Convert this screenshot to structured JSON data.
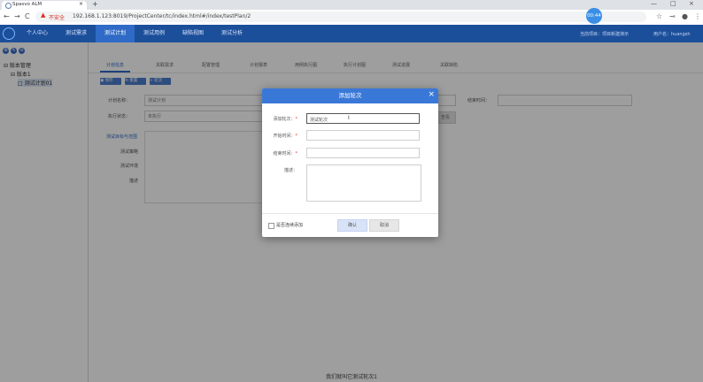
{
  "browser": {
    "tab_title": "Spasvo ALM",
    "tab_close": "×",
    "new_tab": "+",
    "back": "←",
    "forward": "→",
    "reload": "C",
    "insecure_label": "不安全",
    "url": "192.168.1.123:8019/ProjectCenter/tc/index.html#/index/testPlan/2",
    "window_controls": [
      "—",
      "□",
      "×"
    ],
    "toolbar_icons": [
      "☆",
      "⊸",
      "●",
      "⋮"
    ]
  },
  "recording_timer": "00:44",
  "app_nav": {
    "items": [
      "个人中心",
      "测试需求",
      "测试计划",
      "测试用例",
      "缺陷视图",
      "测试分析"
    ],
    "active_index": 2,
    "current_project": "当前项目：项目新建演示",
    "user": "用户名：huangsh"
  },
  "sidebar": {
    "buttons": [
      "⊕",
      "✎",
      "⊖"
    ],
    "tree": [
      {
        "label": "⊟ 版本管理",
        "level": 0
      },
      {
        "label": "⊟ 版本1",
        "level": 1
      },
      {
        "label": "□ 测试计划01",
        "level": 2
      }
    ]
  },
  "subtabs": [
    "计划信息",
    "关联需求",
    "配置管理",
    "计划报表",
    "用例执行图",
    "执行计划图",
    "测试进展",
    "关联缺陷"
  ],
  "action_buttons": [
    "保存",
    "重置",
    "轮次"
  ],
  "form": {
    "plan_name_label": "计划名称：",
    "plan_name_value": "测试计划",
    "status_label": "执行状态：",
    "status_value": "未执行",
    "end_time_label": "结束时间：",
    "filter_button": "查看",
    "scope_title": "测试目标与范围",
    "scope_items": [
      "测试策略",
      "测试环境",
      "描述"
    ]
  },
  "dialog": {
    "title": "添加轮次",
    "close": "×",
    "round_label": "添加轮次：",
    "round_value": "测试轮次",
    "start_label": "开始时间：",
    "end_label": "结束时间：",
    "desc_label": "描述：",
    "continue_label": "是否连续添加",
    "confirm": "确认",
    "cancel": "取消",
    "required_mark": "*"
  },
  "caption": "我们就叫它测试轮次1"
}
